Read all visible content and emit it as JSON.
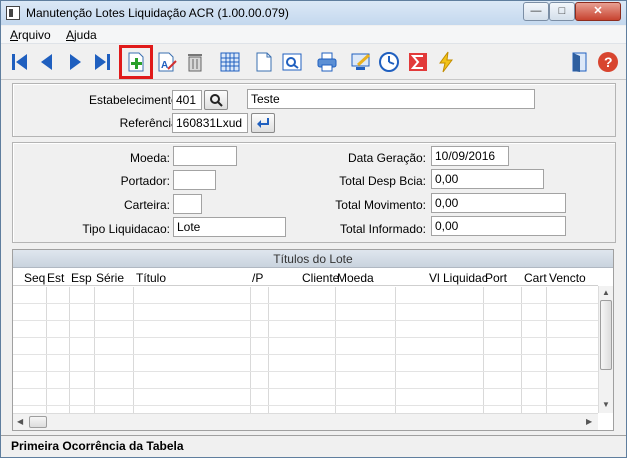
{
  "window": {
    "title": "Manutenção Lotes Liquidação ACR (1.00.00.079)",
    "controls": {
      "minimize": "—",
      "maximize": "□",
      "close": "✕"
    }
  },
  "menu": [
    {
      "label": "Arquivo"
    },
    {
      "label": "Ajuda"
    }
  ],
  "toolbar": {
    "buttons": [
      {
        "icon": "first-record-icon"
      },
      {
        "icon": "previous-record-icon"
      },
      {
        "icon": "next-record-icon"
      },
      {
        "icon": "last-record-icon"
      },
      {
        "icon": "add-record-icon",
        "highlighted": true
      },
      {
        "icon": "edit-record-icon"
      },
      {
        "icon": "delete-icon"
      },
      {
        "icon": "calendar-grid-icon"
      },
      {
        "icon": "blank-document-icon"
      },
      {
        "icon": "preview-icon"
      },
      {
        "icon": "print-icon"
      },
      {
        "icon": "monitor-edit-icon"
      },
      {
        "icon": "clock-icon"
      },
      {
        "icon": "sigma-icon"
      },
      {
        "icon": "lightning-icon"
      },
      {
        "icon": "exit-door-icon"
      },
      {
        "icon": "help-icon"
      }
    ]
  },
  "header": {
    "estabelecimento_label": "Estabelecimento:",
    "estabelecimento_value": "401",
    "estabelecimento_desc": "Teste",
    "referencia_label": "Referência:",
    "referencia_value": "160831Lxud"
  },
  "details": {
    "moeda_label": "Moeda:",
    "moeda_value": "",
    "portador_label": "Portador:",
    "portador_value": "",
    "carteira_label": "Carteira:",
    "carteira_value": "",
    "tipo_label": "Tipo Liquidacao:",
    "tipo_value": "Lote",
    "data_geracao_label": "Data Geração:",
    "data_geracao_value": "10/09/2016",
    "desp_bcia_label": "Total Desp Bcia:",
    "desp_bcia_value": "0,00",
    "movimento_label": "Total Movimento:",
    "movimento_value": "0,00",
    "informado_label": "Total Informado:",
    "informado_value": "0,00"
  },
  "grid": {
    "caption": "Títulos do Lote",
    "columns": [
      "Seq",
      "Est",
      "Esp",
      "Série",
      "Título",
      "/P",
      "Cliente",
      "Moeda",
      "Vl Liquidac",
      "Port",
      "Cart",
      "Vencto"
    ],
    "rows": []
  },
  "status": {
    "text": "Primeira Ocorrência da Tabela"
  },
  "colors": {
    "highlight": "#e01a1a",
    "nav_blue": "#1f5fbf"
  }
}
